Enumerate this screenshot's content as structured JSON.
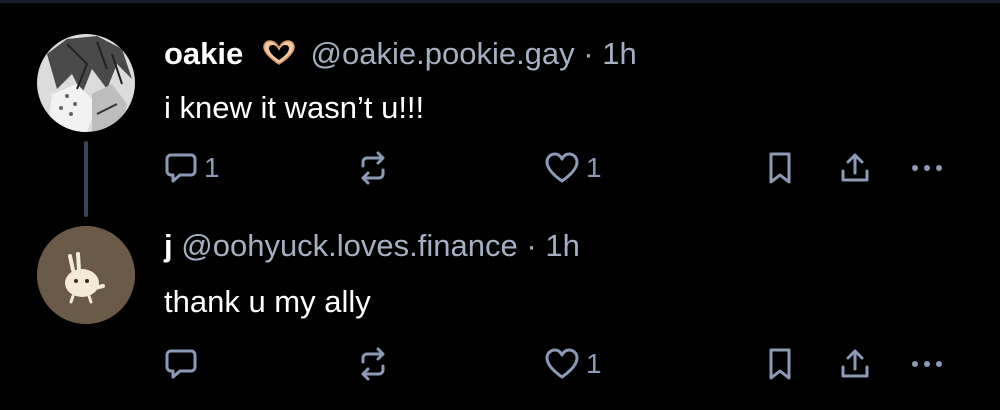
{
  "colors": {
    "background": "#000000",
    "text_primary": "#ffffff",
    "text_secondary": "#a6b0c3",
    "icon": "#8c9ab6",
    "thread_line": "#3a4354",
    "avatar2_bg": "#6b5a48"
  },
  "posts": [
    {
      "display_name": "oakie",
      "name_emoji": "heart-hands-icon",
      "handle": "@oakie.pookie.gay",
      "separator": "·",
      "time": "1h",
      "text": "i knew it wasn’t u!!!",
      "reply_count": "1",
      "like_count": "1"
    },
    {
      "display_name": "j",
      "handle": "@oohyuck.loves.finance",
      "separator": "·",
      "time": "1h",
      "text": "thank u my ally",
      "reply_count": "",
      "like_count": "1"
    }
  ],
  "icons": {
    "reply": "reply-icon",
    "repost": "repost-icon",
    "like": "heart-icon",
    "bookmark": "bookmark-icon",
    "share": "share-icon",
    "more": "more-icon"
  }
}
